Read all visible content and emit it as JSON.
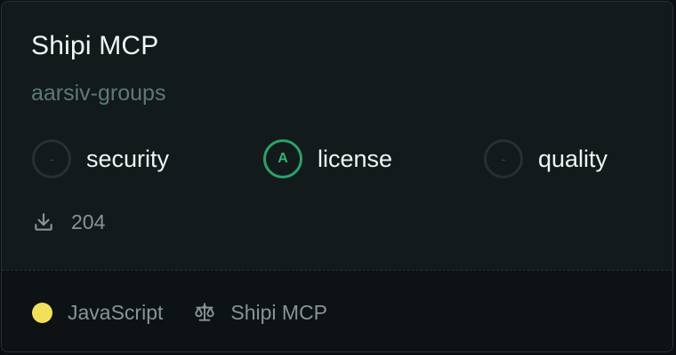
{
  "card": {
    "title": "Shipi MCP",
    "organization": "aarsiv-groups"
  },
  "scores": [
    {
      "grade": "-",
      "label": "security",
      "status": "unrated"
    },
    {
      "grade": "A",
      "label": "license",
      "status": "good",
      "color": "#2fa06a"
    },
    {
      "grade": "-",
      "label": "quality",
      "status": "unrated"
    }
  ],
  "stats": {
    "downloads_icon": "download-icon",
    "downloads": "204"
  },
  "footer": {
    "language": "JavaScript",
    "language_color": "#f1e05a",
    "license_icon": "scale-icon",
    "license": "Shipi MCP"
  }
}
